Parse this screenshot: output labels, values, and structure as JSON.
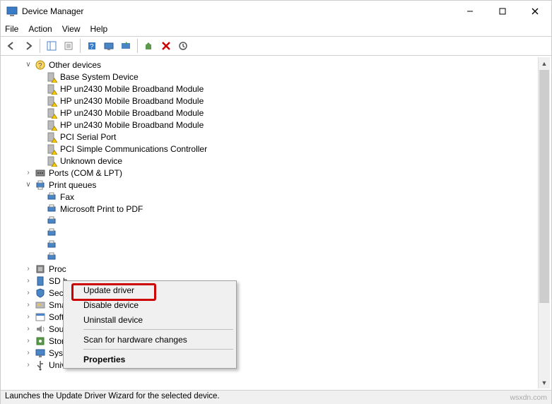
{
  "window": {
    "title": "Device Manager"
  },
  "menu": {
    "file": "File",
    "action": "Action",
    "view": "View",
    "help": "Help"
  },
  "tree": {
    "other_devices": {
      "label": "Other devices",
      "children": {
        "base_system": "Base System Device",
        "hp1": "HP un2430 Mobile Broadband Module",
        "hp2": "HP un2430 Mobile Broadband Module",
        "hp3": "HP un2430 Mobile Broadband Module",
        "hp4": "HP un2430 Mobile Broadband Module",
        "pci_serial": "PCI Serial Port",
        "pci_simple": "PCI Simple Communications Controller",
        "unknown": "Unknown device"
      }
    },
    "ports": "Ports (COM & LPT)",
    "print_queues": {
      "label": "Print queues",
      "children": {
        "fax": "Fax",
        "ms_pdf": "Microsoft Print to PDF"
      }
    },
    "processors": "Proc",
    "sd": "SD h",
    "security": "Secu",
    "smart_card": "Smart card readers",
    "software": "Software devices",
    "sound": "Sound, video and game controllers",
    "storage": "Storage controllers",
    "system": "System devices",
    "usb": "Universal Serial Bus controllers"
  },
  "context_menu": {
    "update": "Update driver",
    "disable": "Disable device",
    "uninstall": "Uninstall device",
    "scan": "Scan for hardware changes",
    "properties": "Properties"
  },
  "statusbar": "Launches the Update Driver Wizard for the selected device.",
  "watermark": "wsxdn.com"
}
